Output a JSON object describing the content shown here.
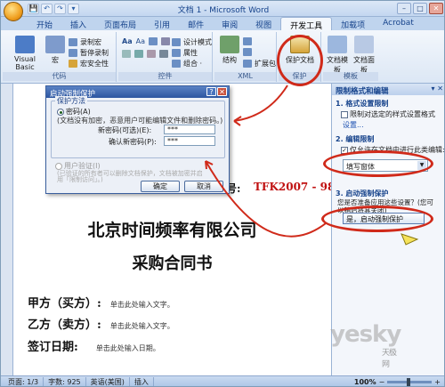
{
  "window": {
    "title": "文档 1 - Microsoft Word",
    "controls": {
      "min": "–",
      "max": "□",
      "close": "✕"
    }
  },
  "qat": [
    "💾",
    "↶",
    "↷",
    "▾"
  ],
  "tabs": [
    "开始",
    "插入",
    "页面布局",
    "引用",
    "邮件",
    "审阅",
    "视图",
    "开发工具",
    "加载项",
    "Acrobat"
  ],
  "ribbon": {
    "code": {
      "visual_basic": "Visual Basic",
      "macro": "宏",
      "record_macro": "录制宏",
      "pause_record": "暂停录制",
      "macro_security": "宏安全性",
      "label": "代码"
    },
    "controls": {
      "design_mode": "设计模式",
      "properties": "属性",
      "group": "组合 ·",
      "label": "控件"
    },
    "xml": {
      "structure": "结构",
      "expansion_pack": "扩展包",
      "label": "XML"
    },
    "protect": {
      "protect_document": "保护文档",
      "label": "保护"
    },
    "templates": {
      "doc_template": "文档模板",
      "doc_panel": "文档面板",
      "label": "模板"
    }
  },
  "document": {
    "contract_no_label": "号:",
    "contract_no": "TFK2007 - 987",
    "company": "北京时间频率有限公司",
    "title": "采购合同书",
    "fields": [
      {
        "label": "甲方（买方）:",
        "placeholder": "单击此处输入文字。"
      },
      {
        "label": "乙方（卖方）:",
        "placeholder": "单击此处输入文字。"
      },
      {
        "label": "签订日期:",
        "placeholder": "单击此处输入日期。"
      }
    ]
  },
  "dialog": {
    "title": "启动强制保护",
    "help": "?",
    "close": "✕",
    "legend": "保护方法",
    "password_option": "密码(A)",
    "password_desc": "(文档没有加密，恶意用户可能编辑文件和删除密码。)",
    "new_password_label": "新密码(可选)(E):",
    "new_password_value": "***",
    "confirm_password_label": "确认新密码(P):",
    "confirm_password_value": "***",
    "user_auth_option": "用户验证(I)",
    "user_auth_desc1": "(已验证的所有者可以删除文档保护，文档被加密并启",
    "user_auth_desc2": "用「限制访问」。)",
    "ok": "确定",
    "cancel": "取消"
  },
  "pane": {
    "title": "限制格式和编辑",
    "close": "▾ ✕",
    "step1": "1. 格式设置限制",
    "step1_check": "限制对选定的样式设置格式",
    "step1_link": "设置...",
    "step2": "2. 编辑限制",
    "step2_check": "仅允许在文档中进行此类编辑:",
    "step2_select": "填写窗体",
    "step3": "3. 启动强制保护",
    "step3_q1": "您是否准备应用这些设置？(您可",
    "step3_q2": "以稍后将其关闭)",
    "step3_button": "是，启动强制保护"
  },
  "status": {
    "page": "页面: 1/3",
    "words": "字数: 925",
    "lang": "英语(美国)",
    "insert": "插入",
    "zoom": "100%"
  },
  "watermark": {
    "brand": "yesky",
    "sub": "天极网"
  },
  "colors": {
    "accent": "#15428b",
    "annotation": "#d02a1a",
    "contract_no": "#c01010"
  }
}
